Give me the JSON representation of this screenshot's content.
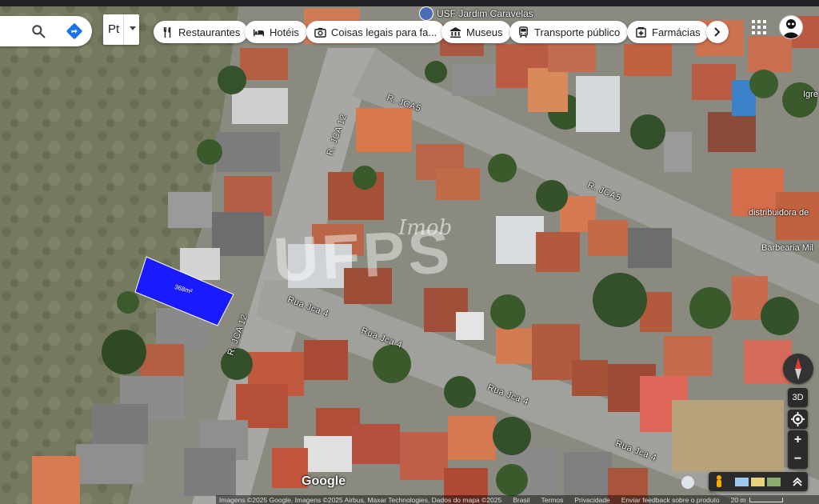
{
  "header": {
    "language_label": "Pt"
  },
  "chips": [
    {
      "label": "Restaurantes",
      "icon": "fork-knife-icon"
    },
    {
      "label": "Hotéis",
      "icon": "bed-icon"
    },
    {
      "label": "Coisas legais para fa...",
      "icon": "camera-icon"
    },
    {
      "label": "Museus",
      "icon": "museum-icon"
    },
    {
      "label": "Transporte público",
      "icon": "train-icon"
    },
    {
      "label": "Farmácias",
      "icon": "pharmacy-icon"
    }
  ],
  "map": {
    "poi": {
      "label": "USF Jardim Caravelas",
      "icon": "clinic-pin-icon"
    },
    "streets": [
      {
        "name": "R. JCA5"
      },
      {
        "name": "R. JCA5"
      },
      {
        "name": "R. JCA 12"
      },
      {
        "name": "R. JCA 12"
      },
      {
        "name": "Rua Jca 4"
      },
      {
        "name": "Rua Jca 4"
      },
      {
        "name": "Rua Jca 4"
      },
      {
        "name": "Rua Jca 4"
      }
    ],
    "places": [
      {
        "name": "Igre"
      },
      {
        "name": "distribuidora de"
      },
      {
        "name": "Barbearia Mil"
      }
    ],
    "lot": {
      "area_label": "368m²",
      "color": "#1a1aff"
    },
    "watermark": {
      "brand": "UFPS",
      "sub": "Imob"
    }
  },
  "branding": {
    "logo": "Google"
  },
  "footer": {
    "attribution": "Imagens ©2025 Google, Imagens ©2025 Airbus, Maxar Technologies, Dados do mapa ©2025",
    "links": [
      "Brasil",
      "Termos",
      "Privacidade",
      "Enviar feedback sobre o produto"
    ],
    "scale": "20 m"
  },
  "controls": {
    "view_3d_label": "3D",
    "zoom_in": "+",
    "zoom_out": "−"
  },
  "colors": {
    "chip_bg": "#ffffff",
    "control_bg": "#2b2b2b",
    "directions_blue": "#1a73e8",
    "lot_blue": "#1a1aff"
  }
}
